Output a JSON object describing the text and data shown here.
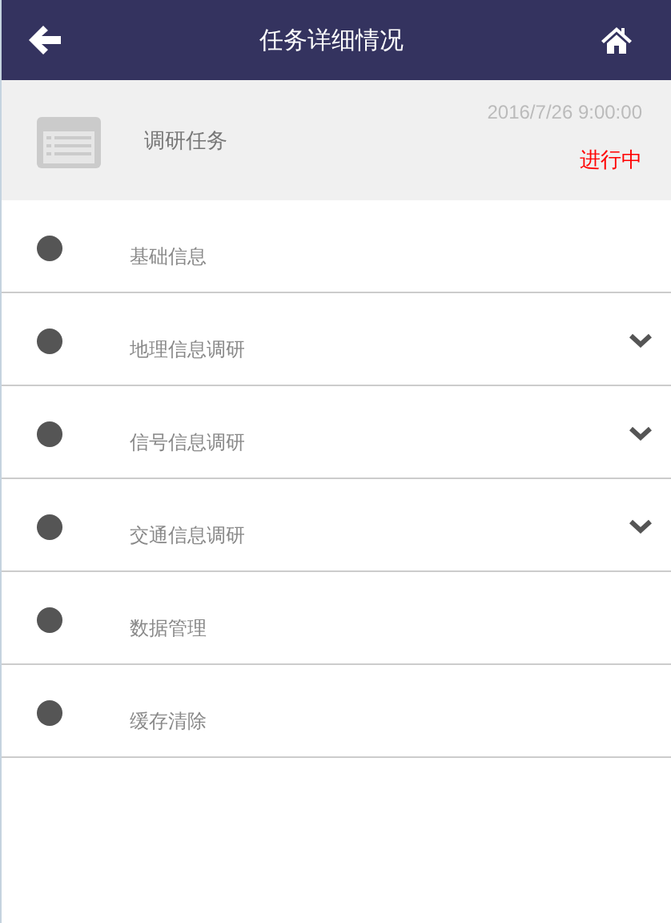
{
  "header": {
    "title": "任务详细情况"
  },
  "task": {
    "name": "调研任务",
    "time": "2016/7/26 9:00:00",
    "status": "进行中"
  },
  "menu": [
    {
      "label": "基础信息",
      "kind": "plain"
    },
    {
      "label": "地理信息调研",
      "kind": "expandable"
    },
    {
      "label": "信号信息调研",
      "kind": "expandable"
    },
    {
      "label": "交通信息调研",
      "kind": "expandable"
    },
    {
      "label": "数据管理",
      "kind": "plain"
    },
    {
      "label": "缓存清除",
      "kind": "plain"
    }
  ]
}
